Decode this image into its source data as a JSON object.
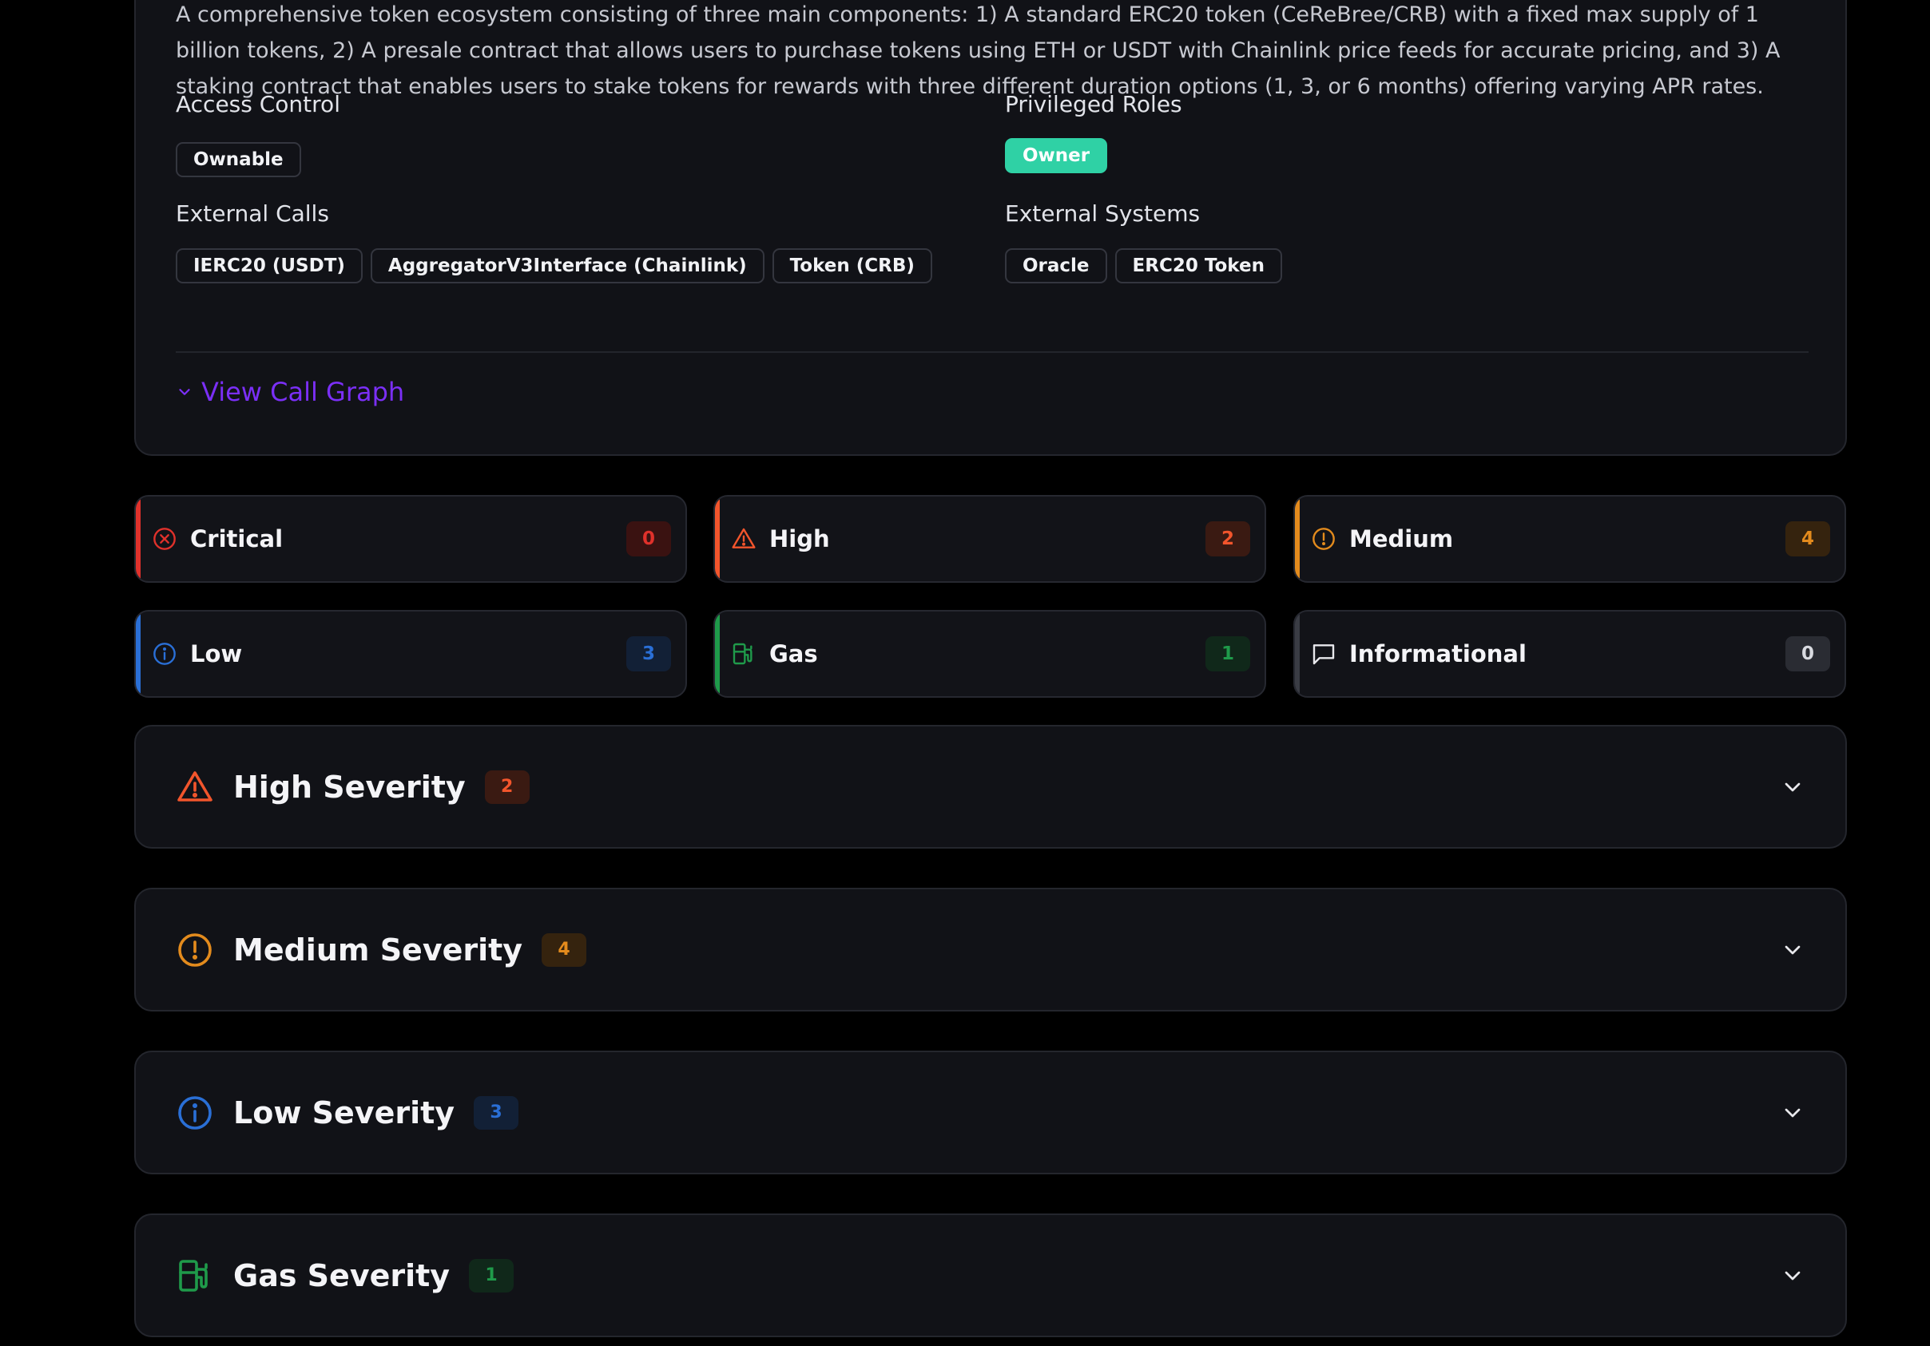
{
  "overview": {
    "description": "A comprehensive token ecosystem consisting of three main components: 1) A standard ERC20 token (CeReBree/CRB) with a fixed max supply of 1 billion tokens, 2) A presale contract that allows users to purchase tokens using ETH or USDT with Chainlink price feeds for accurate pricing, and 3) A staking contract that enables users to stake tokens for rewards with three different duration options (1, 3, or 6 months) offering varying APR rates.",
    "access_control_label": "Access Control",
    "access_control": [
      "Ownable"
    ],
    "privileged_roles_label": "Privileged Roles",
    "privileged_roles": [
      "Owner"
    ],
    "external_calls_label": "External Calls",
    "external_calls": [
      "IERC20 (USDT)",
      "AggregatorV3Interface (Chainlink)",
      "Token (CRB)"
    ],
    "external_systems_label": "External Systems",
    "external_systems": [
      "Oracle",
      "ERC20 Token"
    ],
    "view_call_graph": "View Call Graph"
  },
  "summary": [
    {
      "name": "Critical",
      "count": "0",
      "accent": "#e0312b",
      "icon": "x-circle-icon"
    },
    {
      "name": "High",
      "count": "2",
      "accent": "#f2552c",
      "icon": "alert-triangle-icon"
    },
    {
      "name": "Medium",
      "count": "4",
      "accent": "#e38b1d",
      "icon": "alert-circle-icon"
    },
    {
      "name": "Low",
      "count": "3",
      "accent": "#2a6fd6",
      "icon": "info-icon"
    },
    {
      "name": "Gas",
      "count": "1",
      "accent": "#1f9a4a",
      "icon": "fuel-icon"
    },
    {
      "name": "Informational",
      "count": "0",
      "accent": "#3a3c44",
      "icon": "message-square-icon"
    }
  ],
  "sections": [
    {
      "title": "High Severity",
      "count": "2",
      "accent": "#f2552c",
      "icon": "alert-triangle-icon"
    },
    {
      "title": "Medium Severity",
      "count": "4",
      "accent": "#e38b1d",
      "icon": "alert-circle-icon"
    },
    {
      "title": "Low Severity",
      "count": "3",
      "accent": "#2a6fd6",
      "icon": "info-icon"
    },
    {
      "title": "Gas Severity",
      "count": "1",
      "accent": "#1f9a4a",
      "icon": "fuel-icon"
    }
  ]
}
